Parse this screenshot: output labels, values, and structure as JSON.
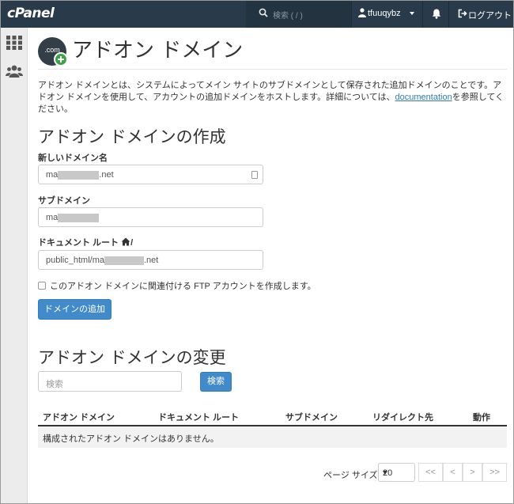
{
  "topbar": {
    "brand": "cPanel",
    "search_placeholder": "検索 ( / )",
    "username": "tfuuqybz",
    "logout_label": "ログアウト"
  },
  "sidebar": {
    "items": [
      {
        "icon": "grid-icon"
      },
      {
        "icon": "users-icon"
      }
    ]
  },
  "page": {
    "icon_text": ".com",
    "title": "アドオン ドメイン",
    "intro_before": "アドオン ドメインとは、システムによってメイン サイトのサブドメインとして保存された追加ドメインのことです。アドオン ドメインを使用して、アカウントの追加ドメインをホストします。詳細については、",
    "intro_link": "documentation",
    "intro_after": "を参照してください。"
  },
  "create": {
    "heading": "アドオン ドメインの作成",
    "domain_label": "新しいドメイン名",
    "domain_value_prefix": "ma",
    "domain_value_suffix": ".net",
    "subdomain_label": "サブドメイン",
    "subdomain_value_prefix": "ma",
    "docroot_label": "ドキュメント ルート",
    "docroot_suffix": "/",
    "docroot_value_prefix": "public_html/ma",
    "docroot_value_suffix": ".net",
    "ftp_checkbox_label": "このアドオン ドメインに関連付ける FTP アカウントを作成します。",
    "ftp_checked": false,
    "submit_label": "ドメインの追加"
  },
  "modify": {
    "heading": "アドオン ドメインの変更",
    "search_placeholder": "検索",
    "search_button": "検索",
    "columns": [
      "アドオン ドメイン",
      "ドキュメント ルート",
      "サブドメイン",
      "リダイレクト先",
      "動作"
    ],
    "empty_message": "構成されたアドオン ドメインはありません。",
    "page_size_label": "ページ サイズ",
    "page_size_value": "20",
    "pager": [
      "<<",
      "<",
      ">",
      ">>"
    ]
  },
  "colors": {
    "topbar": "#293a4a",
    "primary_button": "#428bca",
    "link": "#337ab7",
    "add_badge": "#3ca34a"
  }
}
